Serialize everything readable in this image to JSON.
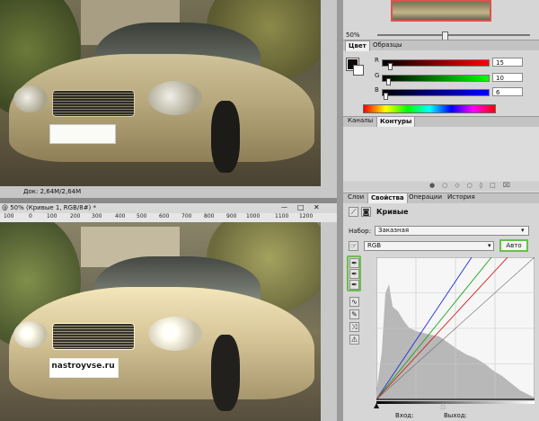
{
  "top_doc": {
    "status": "Док: 2,64M/2,64M"
  },
  "doc": {
    "title": "@ 50% (Кривые 1, RGB/8#) *",
    "minimize": "—",
    "maximize": "□",
    "close": "✕",
    "plate_text": "nastroyvse.ru",
    "ruler_ticks": [
      "100",
      "0",
      "100",
      "200",
      "300",
      "400",
      "500",
      "600",
      "700",
      "800",
      "900",
      "1000",
      "1100",
      "1200"
    ]
  },
  "navigator": {
    "zoom": "50%"
  },
  "color_panel": {
    "tabs": [
      "Цвет",
      "Образцы"
    ],
    "channels": [
      {
        "label": "R",
        "value": "15",
        "fraction": 0.06,
        "gradient": "linear-gradient(90deg,#000,#ff0000)"
      },
      {
        "label": "G",
        "value": "10",
        "fraction": 0.04,
        "gradient": "linear-gradient(90deg,#000,#00ff00)"
      },
      {
        "label": "B",
        "value": "6",
        "fraction": 0.02,
        "gradient": "linear-gradient(90deg,#000,#0000ff)"
      }
    ],
    "foreground": "#0f0a06",
    "background": "#ffffff"
  },
  "channels_panel": {
    "tabs": [
      "Каналы",
      "Контуры"
    ]
  },
  "properties_panel": {
    "tabs": [
      "Слои",
      "Свойства",
      "Операции",
      "История"
    ],
    "title": "Кривые",
    "preset_label": "Набор:",
    "preset_value": "Заказная",
    "channel_value": "RGB",
    "auto_button": "Авто",
    "input_label": "Вход:",
    "output_label": "Выход:"
  },
  "colors": {
    "highlight_green": "#6abf4b",
    "panel_bg": "#d6d6d6"
  }
}
